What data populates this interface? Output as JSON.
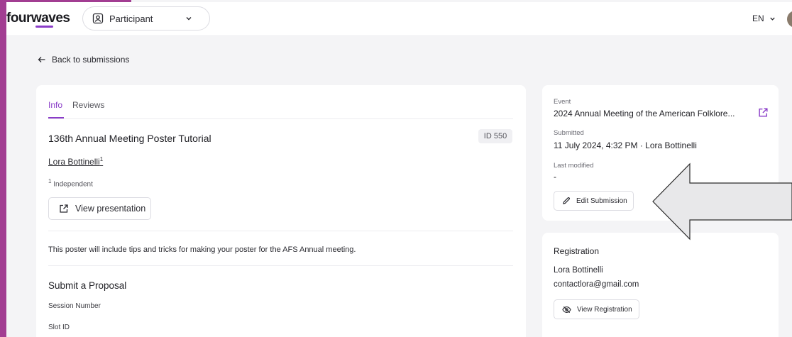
{
  "header": {
    "logo_text": "fourwaves",
    "role_select": {
      "selected": "Participant",
      "icon": "user-badge-icon"
    },
    "language": "EN"
  },
  "nav": {
    "back_label": "Back to submissions"
  },
  "submission": {
    "tabs": [
      {
        "label": "Info",
        "active": true
      },
      {
        "label": "Reviews",
        "active": false
      }
    ],
    "title": "136th Annual Meeting Poster Tutorial",
    "id_badge": "ID 550",
    "author": {
      "name": "Lora Bottinelli",
      "affiliation_index": "1"
    },
    "affiliation": {
      "index": "1",
      "name": "Independent"
    },
    "view_presentation_label": "View presentation",
    "description": "This poster will include tips and tricks for making your poster for the AFS Annual meeting.",
    "proposal": {
      "title": "Submit a Proposal",
      "fields": [
        "Session Number",
        "Slot ID"
      ]
    }
  },
  "event_panel": {
    "event_label": "Event",
    "event_value": "2024 Annual Meeting of the American Folklore...",
    "submitted_label": "Submitted",
    "submitted_value": "11 July 2024, 4:32 PM · Lora Bottinelli",
    "modified_label": "Last modified",
    "modified_value": "-",
    "edit_label": "Edit Submission"
  },
  "registration": {
    "title": "Registration",
    "name": "Lora Bottinelli",
    "email": "contactlora@gmail.com",
    "view_label": "View Registration"
  },
  "colors": {
    "accent": "#8a3cc8",
    "sidebar_strip": "#a23d92",
    "page_bg": "#f4f4f6"
  }
}
